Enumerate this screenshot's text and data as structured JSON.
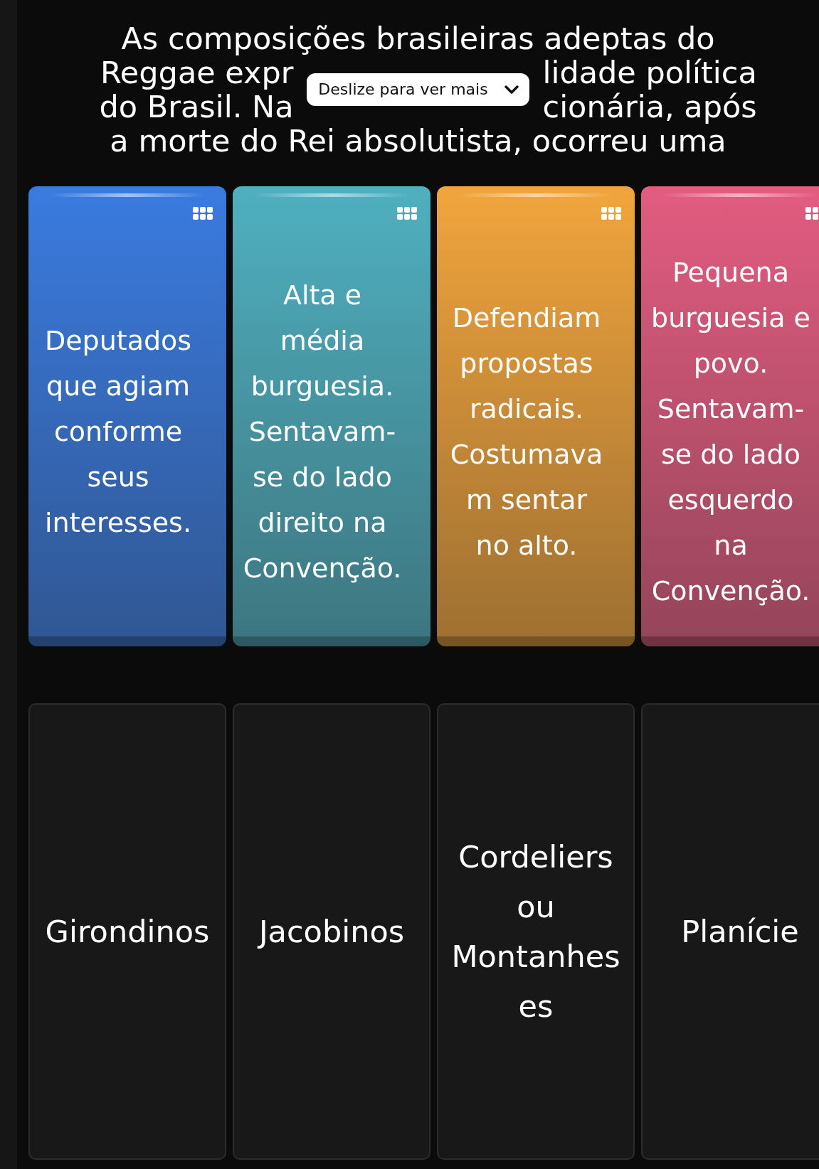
{
  "question_lines": [
    [
      "As composições brasileiras adeptas do"
    ],
    [
      "Reggae expr",
      "lidade política"
    ],
    [
      "do Brasil. Na",
      "cionária, após"
    ],
    [
      "a morte do Rei absolutista, ocorreu uma"
    ]
  ],
  "scroll_hint": {
    "label": "Deslize para ver mais"
  },
  "cards": [
    {
      "text": "Deputados que agiam conforme seus interesses.",
      "color": "#3a7be0"
    },
    {
      "text": "Alta e média burguesia. Sentavam-se do lado direito na Convenção.",
      "color": "#4fb0c0"
    },
    {
      "text": "Defendiam propostas radicais. Costumavam sentar no alto.",
      "color": "#f2a53c"
    },
    {
      "text": "Pequena burguesia e povo. Sentavam-se do lado esquerdo na Convenção.",
      "color": "#e35c80"
    }
  ],
  "targets": [
    {
      "label": "Girondinos"
    },
    {
      "label": "Jacobinos"
    },
    {
      "label": "Cordeliers ou Montanheses"
    },
    {
      "label": "Planície"
    }
  ]
}
